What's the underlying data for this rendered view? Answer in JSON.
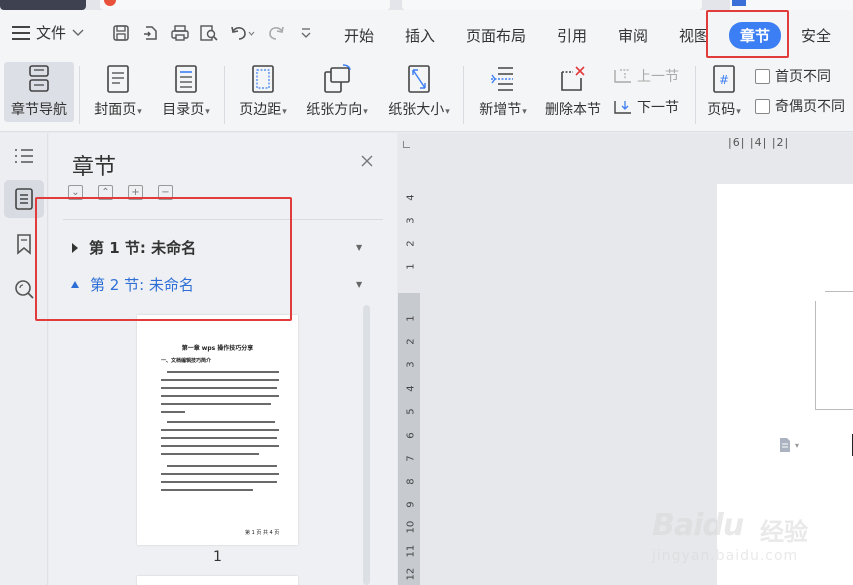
{
  "menubar": {
    "file_label": "文件",
    "tabs": [
      "开始",
      "插入",
      "页面布局",
      "引用",
      "审阅",
      "视图",
      "章节",
      "安全"
    ],
    "active_tab": "章节"
  },
  "ribbon": {
    "buttons": {
      "nav": "章节导航",
      "cover": "封面页",
      "toc": "目录页",
      "margin": "页边距",
      "orientation": "纸张方向",
      "size": "纸张大小",
      "new_section": "新增节",
      "delete_section": "删除本节",
      "prev_section": "上一节",
      "next_section": "下一节",
      "page_number": "页码"
    },
    "checkboxes": {
      "first_page_diff": "首页不同",
      "odd_even_diff": "奇偶页不同"
    }
  },
  "panel": {
    "title": "章节",
    "sections": [
      "第 1 节: 未命名",
      "第 2 节: 未命名"
    ],
    "thumbnail": {
      "title": "第一章 wps 操作技巧分享",
      "heading": "一、文档编辑技巧简介",
      "footer": "第 1 页 共 4 页"
    },
    "page_number": "1"
  },
  "ruler": {
    "top_marks": "|6|  |4|  |2|",
    "vertical_top": [
      "4",
      "3",
      "2",
      "1"
    ],
    "vertical_main": [
      "1",
      "2",
      "3",
      "4",
      "5",
      "6",
      "7",
      "8",
      "9",
      "10",
      "11",
      "12"
    ]
  },
  "watermark": {
    "logo": "Baidu",
    "cn": "经验",
    "url": "jingyan.baidu.com"
  },
  "colors": {
    "accent": "#3c7ef3",
    "highlight_box": "#e23b3b",
    "section_link": "#2d6fd6"
  }
}
